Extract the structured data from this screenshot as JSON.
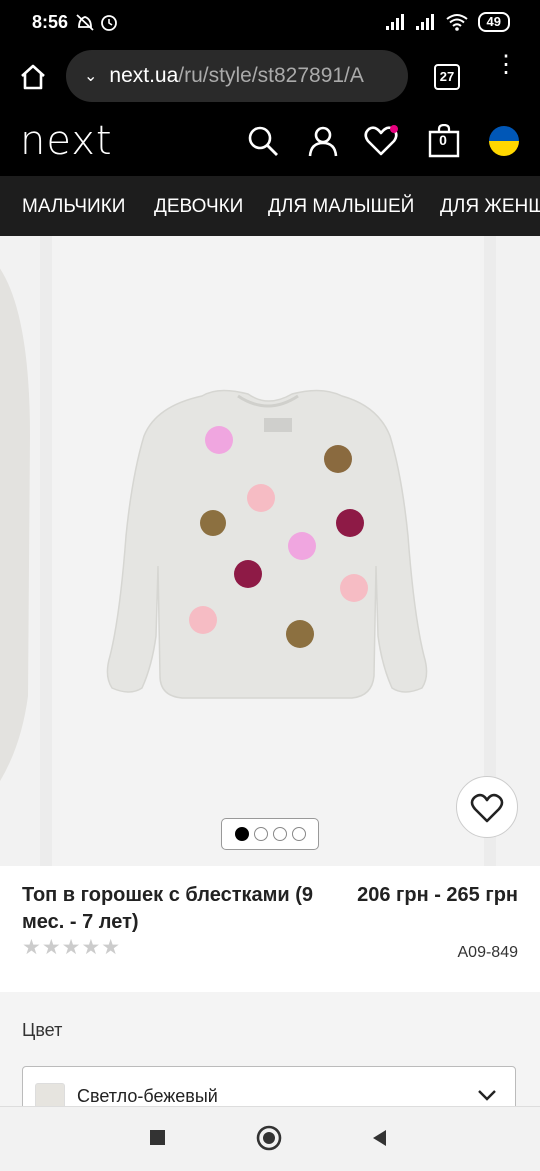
{
  "status": {
    "time": "8:56",
    "battery": "49"
  },
  "browser": {
    "url_domain": "next.ua",
    "url_path": "/ru/style/st827891/A",
    "tab_count": "27"
  },
  "site": {
    "logo": "next",
    "cart_count": "0",
    "nav": [
      "МАЛЬЧИКИ",
      "ДЕВОЧКИ",
      "ДЛЯ МАЛЫШЕЙ",
      "ДЛЯ ЖЕНЩИН"
    ]
  },
  "gallery": {
    "image_count": 4,
    "active_index": 0
  },
  "product": {
    "title": "Топ в горошек с блестками (9 мес. - 7 лет)",
    "price": "206 грн - 265 грн",
    "code": "A09-849",
    "rating_stars": 5
  },
  "options": {
    "color_label": "Цвет",
    "color_value": "Светло-бежевый"
  },
  "colors": {
    "accent": "#e6007e",
    "ua_blue": "#0057b7",
    "ua_yellow": "#ffd700"
  }
}
